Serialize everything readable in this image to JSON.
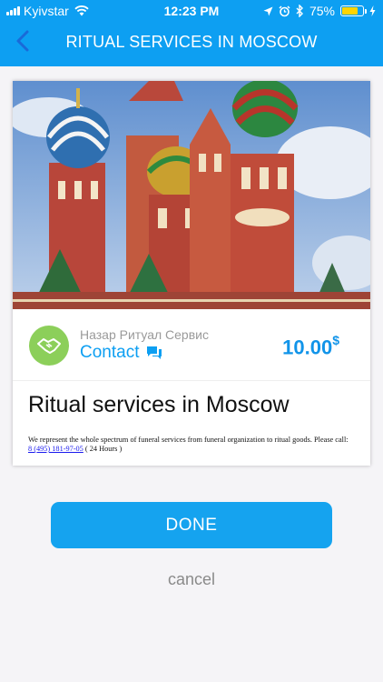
{
  "status_bar": {
    "carrier": "Kyivstar",
    "time": "12:23 PM",
    "battery_percent": "75%",
    "battery_level": 0.75
  },
  "nav": {
    "title": "RITUAL SERVICES IN MOSCOW",
    "back_icon": "chevron-left-icon"
  },
  "card": {
    "company": "Назар Ритуал Сервис",
    "contact_label": "Contact",
    "price": "10.00",
    "currency": "$",
    "title": "Ritual services in Moscow",
    "description": "We represent the whole spectrum of funeral services from funeral organization to ritual goods. Please call:",
    "phone": "8 (495) 181-97-05",
    "hours": " ( 24 Hours )"
  },
  "actions": {
    "done_label": "DONE",
    "cancel_label": "cancel"
  },
  "colors": {
    "accent": "#0d9ff2",
    "avatar": "#8ccf5a"
  }
}
